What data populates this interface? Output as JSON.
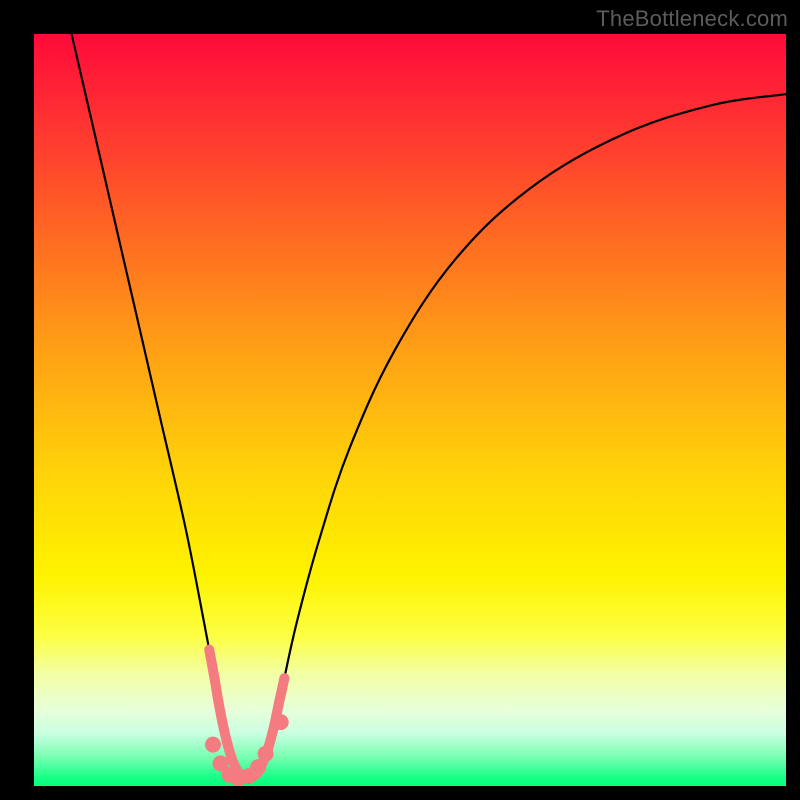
{
  "attribution": "TheBottleneck.com",
  "chart_data": {
    "type": "line",
    "title": "",
    "xlabel": "",
    "ylabel": "",
    "xlim": [
      0,
      1
    ],
    "ylim": [
      0,
      1
    ],
    "series": [
      {
        "name": "bottleneck-curve",
        "x": [
          0.05,
          0.08,
          0.11,
          0.14,
          0.17,
          0.2,
          0.22,
          0.238,
          0.25,
          0.26,
          0.27,
          0.28,
          0.29,
          0.3,
          0.315,
          0.33,
          0.35,
          0.38,
          0.42,
          0.48,
          0.56,
          0.66,
          0.78,
          0.9,
          1.0
        ],
        "y": [
          1.0,
          0.87,
          0.74,
          0.61,
          0.48,
          0.35,
          0.25,
          0.155,
          0.085,
          0.045,
          0.02,
          0.01,
          0.012,
          0.02,
          0.06,
          0.13,
          0.22,
          0.33,
          0.45,
          0.58,
          0.7,
          0.795,
          0.865,
          0.905,
          0.92
        ]
      }
    ],
    "markers": {
      "name": "highlight-points",
      "color": "#f47b7f",
      "points": [
        {
          "x": 0.238,
          "y": 0.055
        },
        {
          "x": 0.248,
          "y": 0.03
        },
        {
          "x": 0.26,
          "y": 0.015
        },
        {
          "x": 0.272,
          "y": 0.01
        },
        {
          "x": 0.285,
          "y": 0.013
        },
        {
          "x": 0.298,
          "y": 0.025
        },
        {
          "x": 0.308,
          "y": 0.043
        },
        {
          "x": 0.328,
          "y": 0.085
        }
      ]
    },
    "background_gradient": {
      "top": "#ff0a3a",
      "mid": "#fff300",
      "bottom": "#05ff7c"
    }
  }
}
